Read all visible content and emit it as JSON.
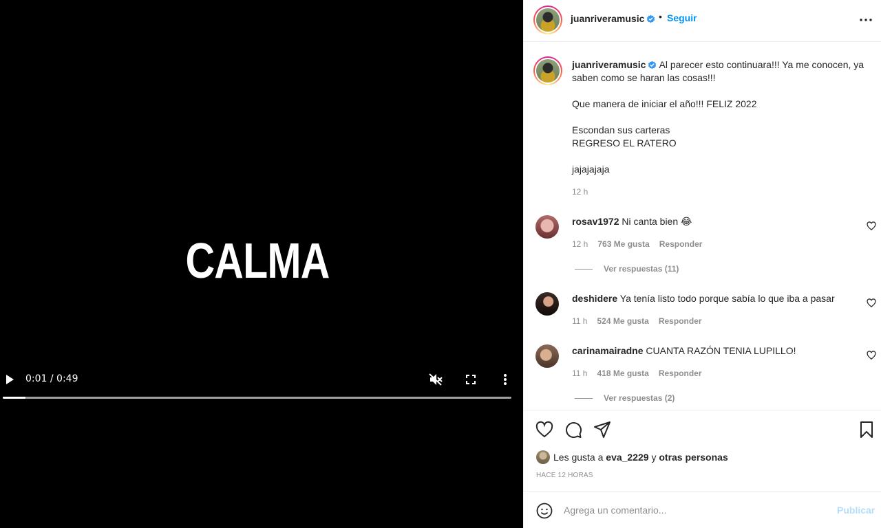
{
  "video": {
    "overlay_text": "CALMA",
    "time": "0:01 / 0:49",
    "progress": 0.045,
    "muted": true
  },
  "header": {
    "username": "juanriveramusic",
    "separator": "•",
    "follow_label": "Seguir"
  },
  "caption": {
    "username": "juanriveramusic",
    "lines": [
      "Al parecer esto continuara!!! Ya me conocen, ya saben como se haran las cosas!!!",
      "Que manera de iniciar el año!!! FELIZ 2022",
      "Escondan sus carteras",
      "REGRESO EL RATERO",
      "jajajajaja"
    ],
    "time": "12 h"
  },
  "comments": [
    {
      "username": "rosav1972",
      "text": "Ni canta bien 😂",
      "time": "12 h",
      "likes": "763 Me gusta",
      "reply": "Responder",
      "view_replies": "Ver respuestas (11)"
    },
    {
      "username": "deshidere",
      "text": "Ya tenía listo todo porque sabía lo que iba a pasar",
      "time": "11 h",
      "likes": "524 Me gusta",
      "reply": "Responder",
      "view_replies": ""
    },
    {
      "username": "carinamairadne",
      "text": "CUANTA RAZÓN TENIA LUPILLO!",
      "time": "11 h",
      "likes": "418 Me gusta",
      "reply": "Responder",
      "view_replies": "Ver respuestas (2)"
    }
  ],
  "likes": {
    "prefix": "Les gusta a",
    "user": "eva_2229",
    "joiner": "y",
    "others": "otras personas"
  },
  "posted": "HACE 12 HORAS",
  "comment_box": {
    "placeholder": "Agrega un comentario...",
    "publish_label": "Publicar"
  },
  "colors": {
    "accent": "#0095f6",
    "publish_disabled": "#b2dffc",
    "muted_text": "#8e8e8e"
  }
}
